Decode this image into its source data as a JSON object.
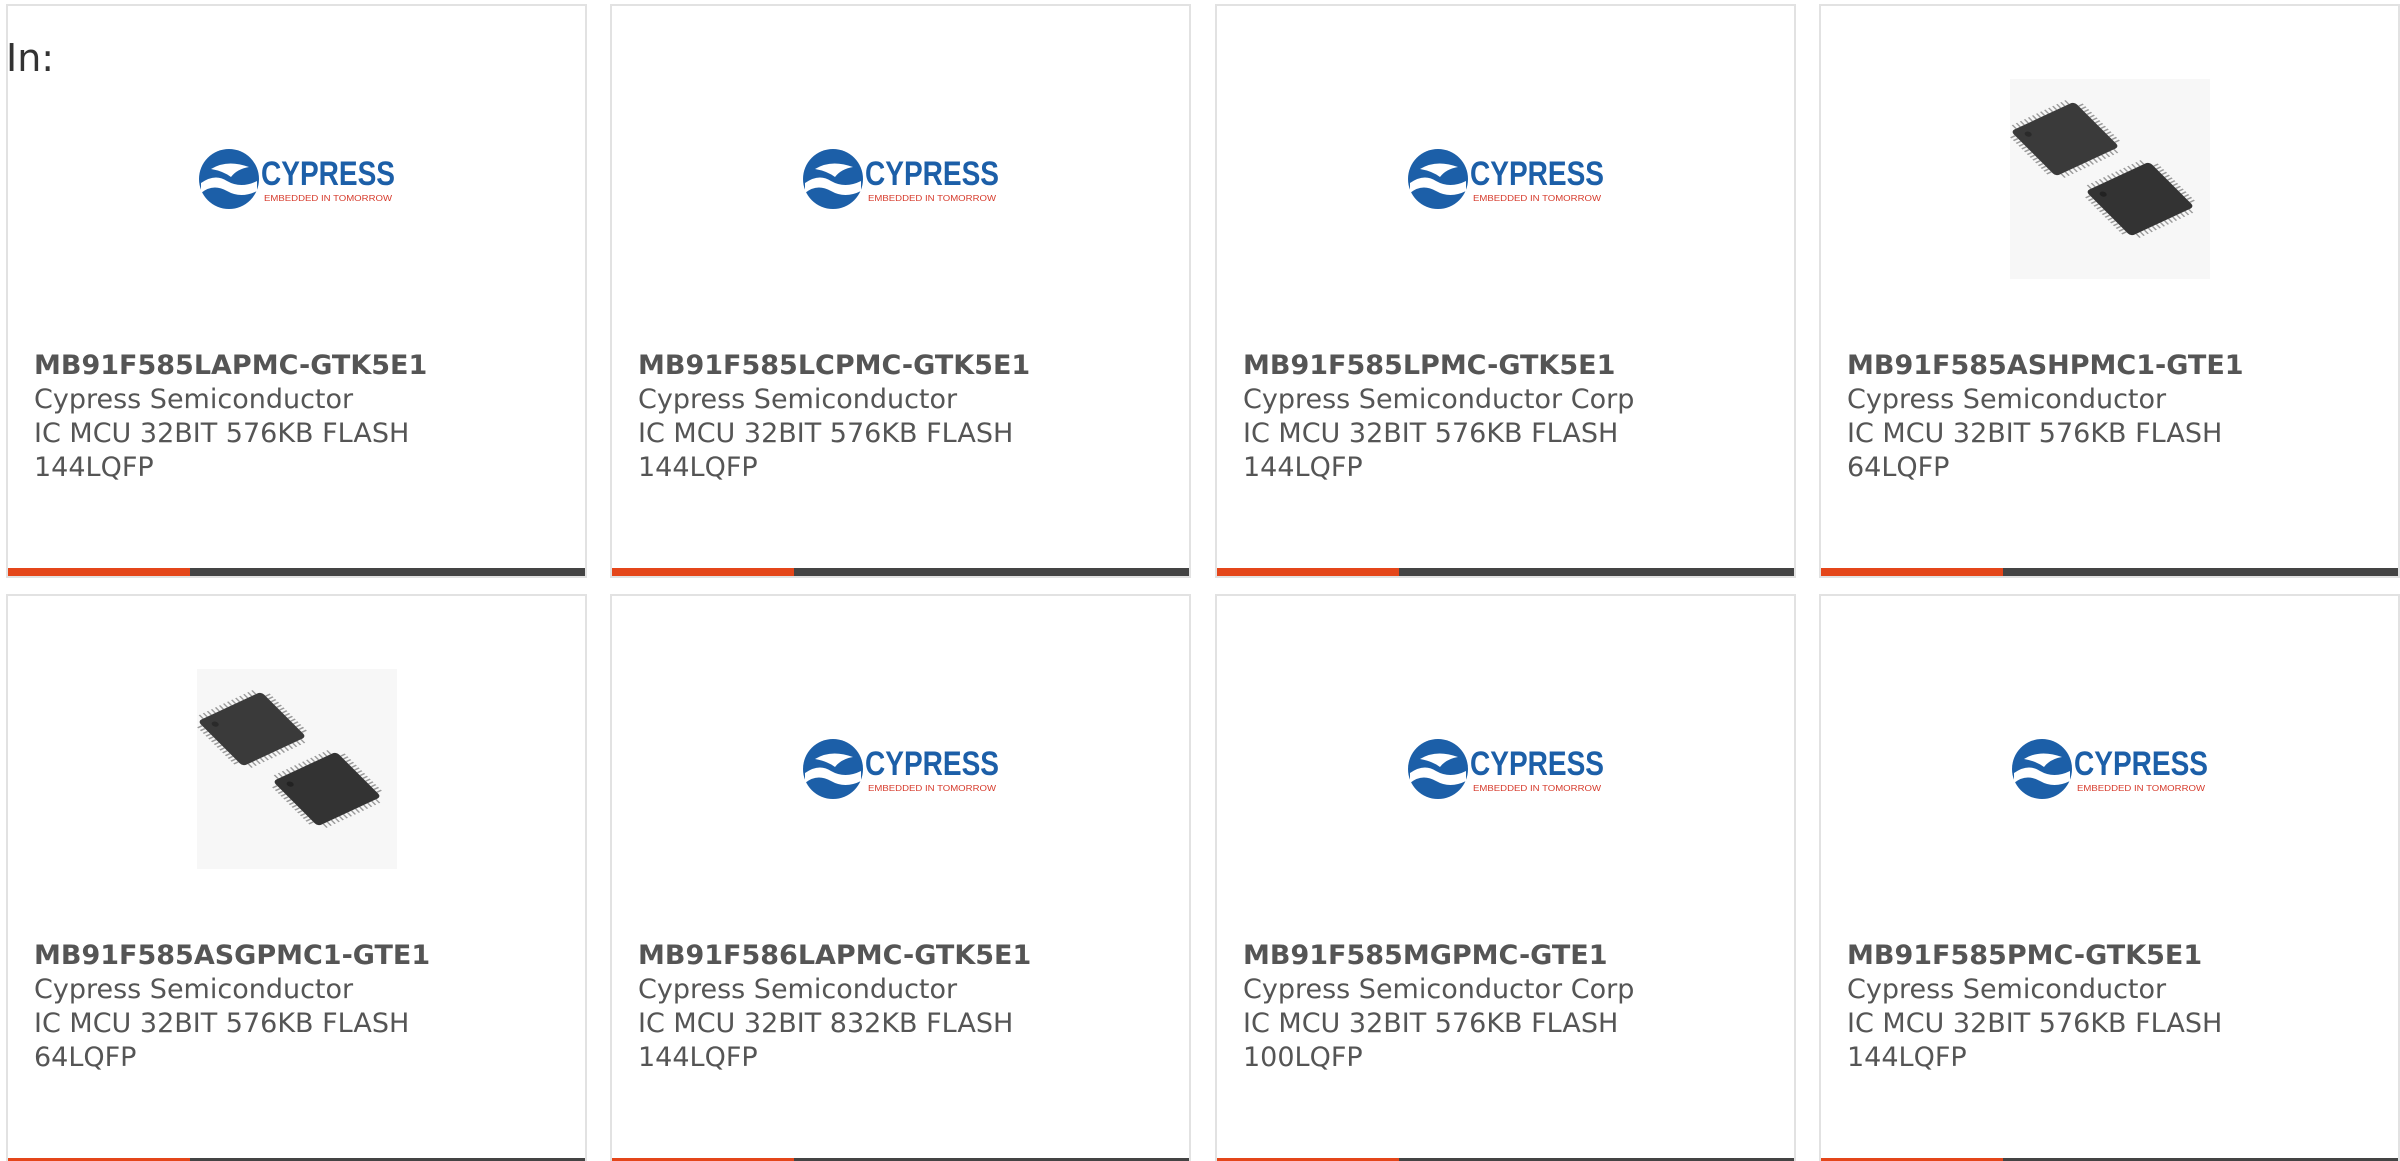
{
  "header": {
    "label": "In:"
  },
  "colors": {
    "accent": "#e4461a",
    "bar": "#444444",
    "border": "#e2e2e2",
    "text": "#555555"
  },
  "products": [
    {
      "part": "MB91F585LAPMC-GTK5E1",
      "manufacturer": "Cypress Semiconductor",
      "desc1": "IC MCU 32BIT 576KB FLASH",
      "desc2": "144LQFP",
      "image": "cypress-logo"
    },
    {
      "part": "MB91F585LCPMC-GTK5E1",
      "manufacturer": "Cypress Semiconductor",
      "desc1": "IC MCU 32BIT 576KB FLASH",
      "desc2": "144LQFP",
      "image": "cypress-logo"
    },
    {
      "part": "MB91F585LPMC-GTK5E1",
      "manufacturer": "Cypress Semiconductor Corp",
      "desc1": "IC MCU 32BIT 576KB FLASH",
      "desc2": "144LQFP",
      "image": "cypress-logo"
    },
    {
      "part": "MB91F585ASHPMC1-GTE1",
      "manufacturer": "Cypress Semiconductor",
      "desc1": "IC MCU 32BIT 576KB FLASH",
      "desc2": "64LQFP",
      "image": "chip-photo"
    },
    {
      "part": "MB91F585ASGPMC1-GTE1",
      "manufacturer": "Cypress Semiconductor",
      "desc1": "IC MCU 32BIT 576KB FLASH",
      "desc2": "64LQFP",
      "image": "chip-photo"
    },
    {
      "part": "MB91F586LAPMC-GTK5E1",
      "manufacturer": "Cypress Semiconductor",
      "desc1": "IC MCU 32BIT 832KB FLASH",
      "desc2": "144LQFP",
      "image": "cypress-logo"
    },
    {
      "part": "MB91F585MGPMC-GTE1",
      "manufacturer": "Cypress Semiconductor Corp",
      "desc1": "IC MCU 32BIT 576KB FLASH",
      "desc2": "100LQFP",
      "image": "cypress-logo"
    },
    {
      "part": "MB91F585PMC-GTK5E1",
      "manufacturer": "Cypress Semiconductor",
      "desc1": "IC MCU 32BIT 576KB FLASH",
      "desc2": "144LQFP",
      "image": "cypress-logo"
    }
  ],
  "logo": {
    "brand": "CYPRESS",
    "tagline": "EMBEDDED IN TOMORROW"
  }
}
